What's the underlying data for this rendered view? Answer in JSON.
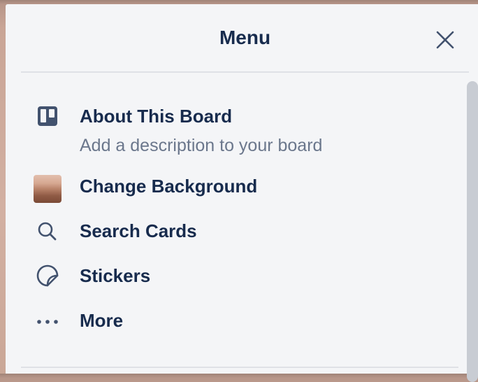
{
  "menu": {
    "title": "Menu",
    "close_icon": "close-icon",
    "items": [
      {
        "label": "About This Board",
        "description": "Add a description to your board",
        "icon": "board-icon"
      },
      {
        "label": "Change Background",
        "icon": "background-thumbnail"
      },
      {
        "label": "Search Cards",
        "icon": "search-icon"
      },
      {
        "label": "Stickers",
        "icon": "sticker-icon"
      },
      {
        "label": "More",
        "icon": "more-icon"
      }
    ]
  },
  "colors": {
    "panel_bg": "#f4f5f7",
    "text_primary": "#172b4d",
    "text_secondary": "#6b778c",
    "divider": "#dfe1e6",
    "scrollbar": "#c8ccd3"
  }
}
